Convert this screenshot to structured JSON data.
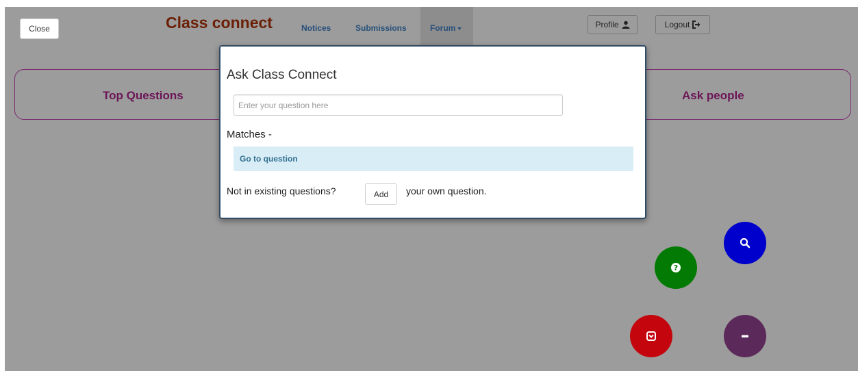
{
  "navbar": {
    "close_label": "Close",
    "brand": "Class connect",
    "links": [
      {
        "label": "Notices"
      },
      {
        "label": "Submissions"
      },
      {
        "label": "Forum"
      }
    ],
    "profile_label": "Profile",
    "logout_label": "Logout"
  },
  "panel": {
    "left_label": "Top Questions",
    "right_label": "Ask people"
  },
  "modal": {
    "title": "Ask Class Connect",
    "input_placeholder": "Enter your question here",
    "input_value": "",
    "matches_label": "Matches -",
    "match_items": [
      {
        "label": "Go to question"
      }
    ],
    "prompt_before": "Not in existing questions?",
    "add_label": "Add",
    "prompt_after": "your own question."
  },
  "fabs": {
    "search_color": "#0000cc",
    "help_color": "#037a03",
    "pocket_color": "#c4050d",
    "minus_color": "#5c2a5a"
  }
}
